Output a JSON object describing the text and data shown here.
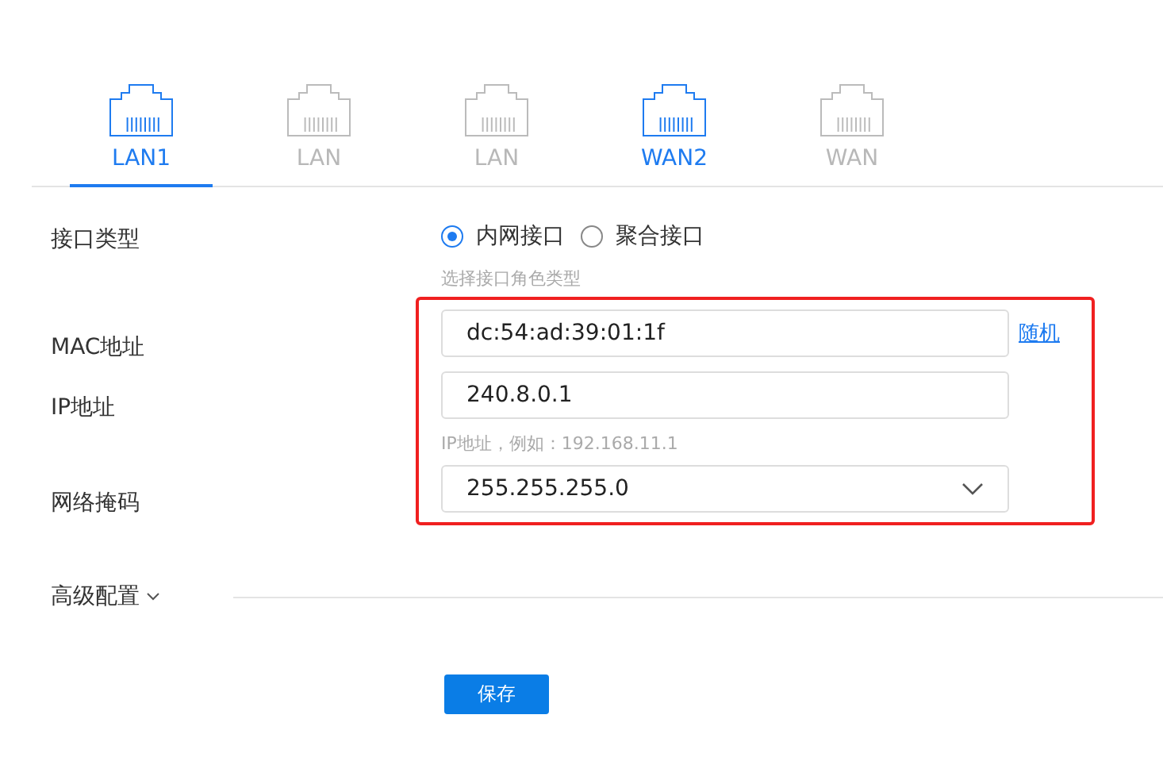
{
  "ports": [
    {
      "label": "LAN1",
      "selected": true,
      "connected": true
    },
    {
      "label": "LAN",
      "selected": false,
      "connected": false
    },
    {
      "label": "LAN",
      "selected": false,
      "connected": false
    },
    {
      "label": "WAN2",
      "selected": false,
      "connected": true
    },
    {
      "label": "WAN",
      "selected": false,
      "connected": false
    }
  ],
  "form": {
    "type_label": "接口类型",
    "radios": [
      {
        "label": "内网接口",
        "selected": true
      },
      {
        "label": "聚合接口",
        "selected": false
      }
    ],
    "type_hint": "选择接口角色类型",
    "mac_label": "MAC地址",
    "mac_value": "dc:54:ad:39:01:1f",
    "random_link": "随机",
    "ip_label": "IP地址",
    "ip_value": "240.8.0.1",
    "ip_hint": "IP地址，例如：192.168.11.1",
    "mask_label": "网络掩码",
    "mask_value": "255.255.255.0"
  },
  "advanced": {
    "label": "高级配置",
    "expanded": false
  },
  "save_button": "保存"
}
